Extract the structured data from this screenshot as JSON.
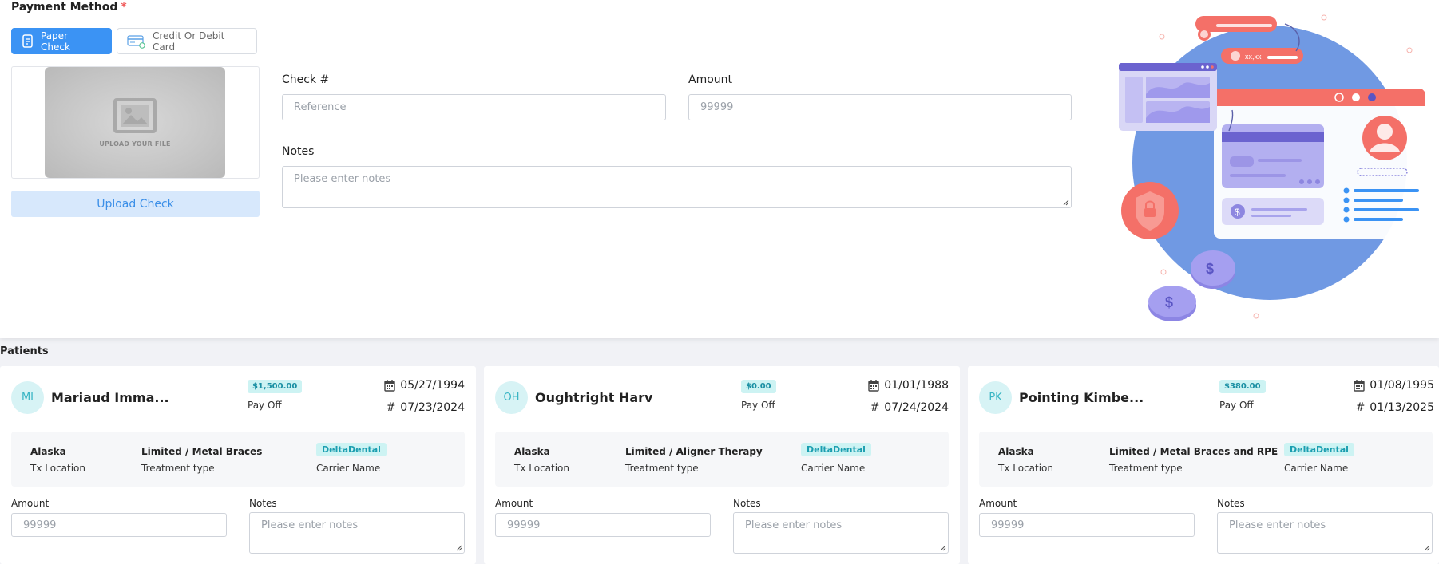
{
  "payment_method": {
    "title": "Payment Method",
    "required_mark": "*",
    "options": [
      {
        "label": "Paper Check",
        "icon": "check-document-icon",
        "active": true
      },
      {
        "label": "Credit Or Debit Card",
        "icon": "credit-card-icon",
        "active": false
      }
    ],
    "upload": {
      "caption": "UPLOAD YOUR FILE",
      "button_label": "Upload Check"
    },
    "check_number": {
      "label": "Check #",
      "placeholder": "Reference"
    },
    "amount": {
      "label": "Amount",
      "placeholder": "99999"
    },
    "notes": {
      "label": "Notes",
      "placeholder": "Please enter notes"
    }
  },
  "illustration": {
    "card_mask": "xx,xx",
    "colors": {
      "accent": "#3b93f4",
      "coral": "#f47068",
      "purple": "#8f85e0",
      "blue_circle": "#6f9ae6"
    }
  },
  "patients": {
    "title": "Patients",
    "cards": [
      {
        "initials": "MI",
        "name": "Mariaud Imma...",
        "amount_badge": "$1,500.00",
        "pay_status": "Pay Off",
        "dob": "05/27/1994",
        "date_number": "07/23/2024",
        "location": "Alaska",
        "location_label": "Tx Location",
        "treatment": "Limited / Metal Braces",
        "treatment_label": "Treatment type",
        "carrier": "DeltaDental",
        "carrier_label": "Carrier Name",
        "amount_label": "Amount",
        "amount_placeholder": "99999",
        "notes_label": "Notes",
        "notes_placeholder": "Please enter notes"
      },
      {
        "initials": "OH",
        "name": "Oughtright Harv",
        "amount_badge": "$0.00",
        "pay_status": "Pay Off",
        "dob": "01/01/1988",
        "date_number": "07/24/2024",
        "location": "Alaska",
        "location_label": "Tx Location",
        "treatment": "Limited / Aligner Therapy",
        "treatment_label": "Treatment type",
        "carrier": "DeltaDental",
        "carrier_label": "Carrier Name",
        "amount_label": "Amount",
        "amount_placeholder": "99999",
        "notes_label": "Notes",
        "notes_placeholder": "Please enter notes"
      },
      {
        "initials": "PK",
        "name": "Pointing Kimbe...",
        "amount_badge": "$380.00",
        "pay_status": "Pay Off",
        "dob": "01/08/1995",
        "date_number": "01/13/2025",
        "location": "Alaska",
        "location_label": "Tx Location",
        "treatment": "Limited / Metal Braces and RPE",
        "treatment_label": "Treatment type",
        "carrier": "DeltaDental",
        "carrier_label": "Carrier Name",
        "amount_label": "Amount",
        "amount_placeholder": "99999",
        "notes_label": "Notes",
        "notes_placeholder": "Please enter notes"
      }
    ]
  }
}
